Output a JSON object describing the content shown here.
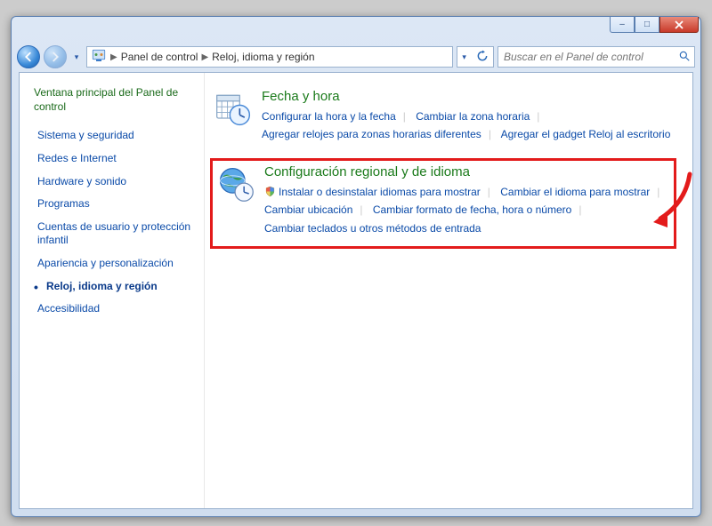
{
  "titlebar": {
    "minimize": "–",
    "maximize": "□"
  },
  "breadcrumb": {
    "root": "Panel de control",
    "current": "Reloj, idioma y región"
  },
  "search": {
    "placeholder": "Buscar en el Panel de control"
  },
  "sidebar": {
    "home": "Ventana principal del Panel de control",
    "items": [
      {
        "label": "Sistema y seguridad",
        "active": false
      },
      {
        "label": "Redes e Internet",
        "active": false
      },
      {
        "label": "Hardware y sonido",
        "active": false
      },
      {
        "label": "Programas",
        "active": false
      },
      {
        "label": "Cuentas de usuario y protección infantil",
        "active": false
      },
      {
        "label": "Apariencia y personalización",
        "active": false
      },
      {
        "label": "Reloj, idioma y región",
        "active": true
      },
      {
        "label": "Accesibilidad",
        "active": false
      }
    ]
  },
  "categories": [
    {
      "title": "Fecha y hora",
      "highlight": false,
      "icon": "clock-calendar-icon",
      "tasks": [
        {
          "label": "Configurar la hora y la fecha",
          "shield": false
        },
        {
          "label": "Cambiar la zona horaria",
          "shield": false
        },
        {
          "label": "Agregar relojes para zonas horarias diferentes",
          "shield": false
        },
        {
          "label": "Agregar el gadget Reloj al escritorio",
          "shield": false
        }
      ]
    },
    {
      "title": "Configuración regional y de idioma",
      "highlight": true,
      "icon": "globe-clock-icon",
      "tasks": [
        {
          "label": "Instalar o desinstalar idiomas para mostrar",
          "shield": true
        },
        {
          "label": "Cambiar el idioma para mostrar",
          "shield": false
        },
        {
          "label": "Cambiar ubicación",
          "shield": false
        },
        {
          "label": "Cambiar formato de fecha, hora o número",
          "shield": false
        },
        {
          "label": "Cambiar teclados u otros métodos de entrada",
          "shield": false
        }
      ]
    }
  ]
}
